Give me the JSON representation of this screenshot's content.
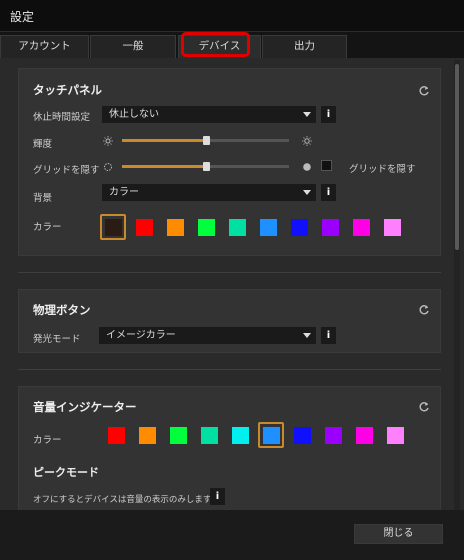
{
  "window": {
    "title": "設定"
  },
  "tabs": [
    {
      "label": "アカウント"
    },
    {
      "label": "一般"
    },
    {
      "label": "デバイス"
    },
    {
      "label": "出力"
    }
  ],
  "touch_panel": {
    "title": "タッチパネル",
    "sleep_label": "休止時間設定",
    "sleep_value": "休止しない",
    "brightness_label": "輝度",
    "brightness_level": 0.5,
    "grid_label": "グリッドを隠す",
    "grid_level": 0.5,
    "grid_check_label": "グリッドを隠す",
    "background_label": "背景",
    "background_value": "カラー",
    "color_label": "カラー",
    "colors": [
      "#2a1c14",
      "#ff0000",
      "#ff8c00",
      "#00ff3c",
      "#00e0a0",
      "#1e90ff",
      "#1010ff",
      "#9b00ff",
      "#ff00e6",
      "#ff80ff"
    ],
    "selected_color_index": 0
  },
  "physical_buttons": {
    "title": "物理ボタン",
    "light_mode_label": "発光モード",
    "light_mode_value": "イメージカラー"
  },
  "volume_indicator": {
    "title": "音量インジケーター",
    "color_label": "カラー",
    "colors": [
      "#ff0000",
      "#ff8c00",
      "#00ff3c",
      "#00e0a0",
      "#00f0f0",
      "#1e90ff",
      "#1010ff",
      "#9b00ff",
      "#ff00e6",
      "#ff80ff"
    ],
    "selected_color_index": 5,
    "peak_mode_title": "ピークモード",
    "peak_mode_desc": "オフにするとデバイスは音量の表示のみします。"
  },
  "footer": {
    "close_label": "閉じる"
  },
  "accent": {
    "slider": "#c88a2a",
    "highlight": "#e00000"
  }
}
